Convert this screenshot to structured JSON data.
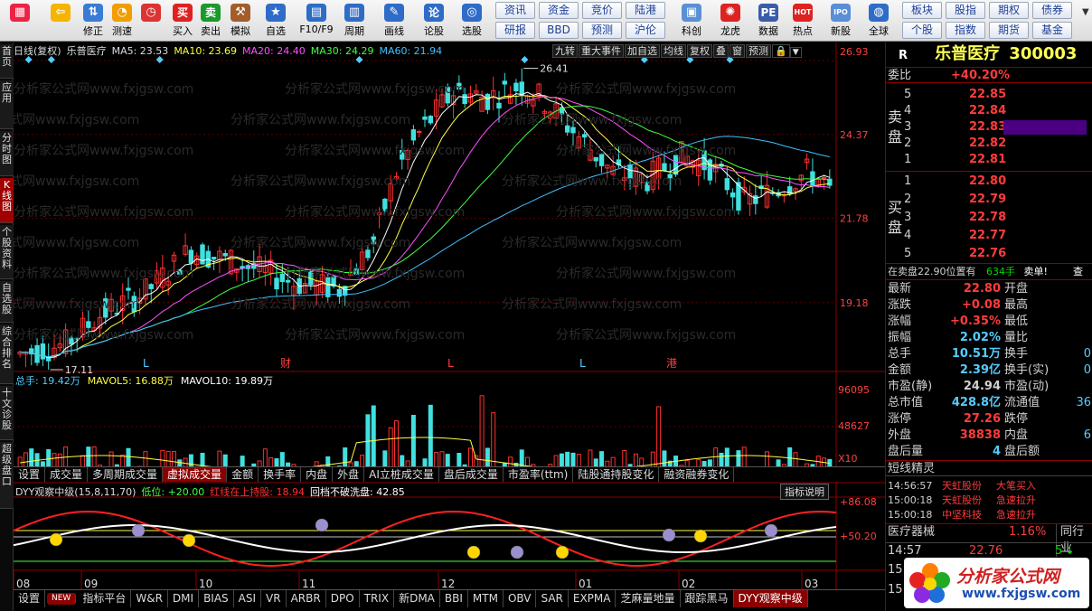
{
  "toolbar": {
    "buttons": [
      {
        "label": "",
        "icon": "grid-app-icon"
      },
      {
        "label": "",
        "icon": "back-arrow-icon"
      },
      {
        "label": "修正",
        "icon": "up-down-icon"
      },
      {
        "label": "测速",
        "icon": "speed-icon"
      },
      {
        "label": "",
        "icon": "clock-icon"
      },
      {
        "label": "买入",
        "icon": "buy-icon",
        "glyph": "买"
      },
      {
        "label": "卖出",
        "icon": "sell-icon",
        "glyph": "卖"
      },
      {
        "label": "模拟",
        "icon": "hammer-icon"
      },
      {
        "label": "自选",
        "icon": "star-icon"
      },
      {
        "label": "F10/F9",
        "icon": "f10-icon"
      },
      {
        "label": "周期",
        "icon": "period-icon"
      },
      {
        "label": "画线",
        "icon": "pencil-icon"
      },
      {
        "label": "论股",
        "icon": "discuss-icon",
        "glyph": "论"
      },
      {
        "label": "选股",
        "icon": "select-icon"
      },
      {
        "label": "科创",
        "icon": "science-icon"
      },
      {
        "label": "龙虎",
        "icon": "dragon-icon"
      },
      {
        "label": "数据",
        "icon": "pe-icon",
        "glyph": "PE"
      },
      {
        "label": "热点",
        "icon": "hot-icon",
        "glyph": "HOT"
      },
      {
        "label": "新股",
        "icon": "ipo-icon",
        "glyph": "IPO"
      },
      {
        "label": "全球",
        "icon": "globe-icon"
      }
    ],
    "small_buttons_row1": [
      "资讯",
      "资金",
      "竞价",
      "陆港"
    ],
    "small_buttons_row2": [
      "研报",
      "BBD",
      "预测",
      "沪伦"
    ],
    "small_buttons_right_row1": [
      "板块",
      "股指",
      "期权",
      "债券"
    ],
    "small_buttons_right_row2": [
      "个股",
      "指数",
      "期货",
      "基金"
    ]
  },
  "leftnav": [
    "首页",
    "应用",
    "分时图",
    "K线图",
    "个股资料",
    "自选股",
    "综合排名",
    "十文诊股",
    "超级盘口"
  ],
  "main_header": {
    "period": "日线(复权)",
    "stock": "乐普医疗",
    "ma5": "MA5: 23.53",
    "ma10": "MA10: 23.69",
    "ma20": "MA20: 24.40",
    "ma30": "MA30: 24.29",
    "ma60": "MA60: 21.94",
    "right_tabs": [
      "九转",
      "重大事件",
      "加自选",
      "均线",
      "复权",
      "叠",
      "窗",
      "预测"
    ]
  },
  "price_axis": [
    "26.93",
    "24.37",
    "21.78",
    "19.18"
  ],
  "price_marks": {
    "high": "26.41",
    "low": "17.11"
  },
  "event_marks": [
    "L",
    "财",
    "L",
    "L",
    "港"
  ],
  "vol_header": {
    "total": "总手: 19.42万",
    "mavol5": "MAVOL5: 16.88万",
    "mavol10": "MAVOL10: 19.89万"
  },
  "vol_axis": [
    "96095",
    "48627",
    "X10"
  ],
  "indicator_tabs": [
    "设置",
    "成交量",
    "多周期成交量",
    "虚拟成交量",
    "金额",
    "换手率",
    "内盘",
    "外盘",
    "AI立桩成交量",
    "盘后成交量",
    "市盈率(ttm)",
    "陆股通持股变化",
    "融资融券变化"
  ],
  "osc_header": {
    "name": "DYY观察中级(15,8,11,70)",
    "low": "低位: +20.00",
    "red": "红线在上持股: 18.94",
    "white": "回档不破洗盘: 42.85",
    "help": "指标说明"
  },
  "osc_axis": [
    "+86.08",
    "+50.20"
  ],
  "months": [
    "08",
    "09",
    "10",
    "11",
    "12",
    "01",
    "02",
    "03"
  ],
  "bottom_tabs": [
    "设置",
    "NEW",
    "指标平台",
    "W&R",
    "DMI",
    "BIAS",
    "ASI",
    "VR",
    "ARBR",
    "DPO",
    "TRIX",
    "新DMA",
    "BBI",
    "MTM",
    "OBV",
    "SAR",
    "EXPMA",
    "芝麻量地量",
    "跟踪黑马",
    "DYY观察中级"
  ],
  "watermark": "分析家公式网www.fxjgsw.com",
  "quote": {
    "r": "R",
    "name": "乐普医疗",
    "code": "300003",
    "weibi_label": "委比",
    "weibi": "+40.20%",
    "sell_label": "卖盘",
    "buy_label": "买盘",
    "asks": [
      {
        "lv": "5",
        "p": "22.85"
      },
      {
        "lv": "4",
        "p": "22.84"
      },
      {
        "lv": "3",
        "p": "22.83"
      },
      {
        "lv": "2",
        "p": "22.82"
      },
      {
        "lv": "1",
        "p": "22.81"
      }
    ],
    "bids": [
      {
        "lv": "1",
        "p": "22.80"
      },
      {
        "lv": "2",
        "p": "22.79"
      },
      {
        "lv": "3",
        "p": "22.78"
      },
      {
        "lv": "4",
        "p": "22.77"
      },
      {
        "lv": "5",
        "p": "22.76"
      }
    ],
    "notice": "在卖盘22.90位置有",
    "notice_qty": "634手",
    "notice_tag": "卖单!",
    "notice_more": "查",
    "stats": [
      {
        "l": "最新",
        "v": "22.80",
        "c": "red",
        "l2": "开盘"
      },
      {
        "l": "涨跌",
        "v": "+0.08",
        "c": "red",
        "l2": "最高"
      },
      {
        "l": "涨幅",
        "v": "+0.35%",
        "c": "red",
        "l2": "最低"
      },
      {
        "l": "振幅",
        "v": "2.02%",
        "c": "cyn",
        "l2": "量比"
      },
      {
        "l": "总手",
        "v": "10.51万",
        "c": "cyn",
        "l2": "换手",
        "v2": "0"
      },
      {
        "l": "金额",
        "v": "2.39亿",
        "c": "cyn",
        "l2": "换手(实)",
        "v2": "0"
      },
      {
        "l": "市盈(静)",
        "v": "24.94",
        "c": "lbl",
        "l2": "市盈(动)"
      },
      {
        "l": "总市值",
        "v": "428.8亿",
        "c": "cyn",
        "l2": "流通值",
        "v2": "36"
      },
      {
        "l": "涨停",
        "v": "27.26",
        "c": "red",
        "l2": "跌停"
      },
      {
        "l": "外盘",
        "v": "38838",
        "c": "red",
        "l2": "内盘",
        "v2": "6"
      },
      {
        "l": "盘后量",
        "v": "4",
        "c": "cyn",
        "l2": "盘后额"
      }
    ],
    "news_title": "短线精灵",
    "news": [
      {
        "t": "14:56:57",
        "s": "天虹股份",
        "e": "大笔买入"
      },
      {
        "t": "15:00:18",
        "s": "天虹股份",
        "e": "急速拉升"
      },
      {
        "t": "15:00:18",
        "s": "中坚科技",
        "e": "急速拉升"
      }
    ],
    "sector": "医疗器械",
    "sector_chg": "1.16%",
    "sector_btn": "同行业",
    "tick": {
      "t": "14:57",
      "p": "22.76",
      "v": "5"
    },
    "tick_rows": [
      "15",
      "15"
    ],
    "brand": "分析家公式网",
    "brand_url": "www.fxjgsw.com"
  },
  "chart_data": {
    "type": "candlestick",
    "title": "乐普医疗 日线(复权)",
    "price_ylim": [
      17.11,
      26.93
    ],
    "high": 26.41,
    "low": 17.11,
    "last_close": 22.8
  }
}
